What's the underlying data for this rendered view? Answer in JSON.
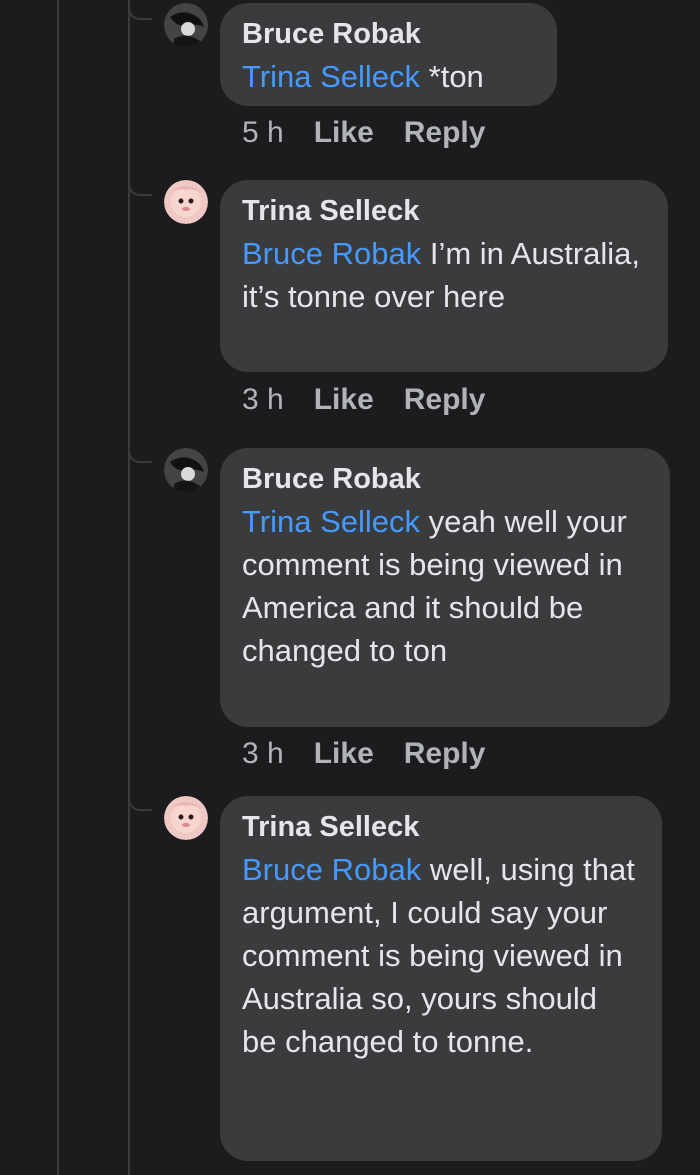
{
  "comments": [
    {
      "author": "Bruce Robak",
      "mention": "Trina Selleck",
      "text": " *ton",
      "time": "5 h",
      "like_label": "Like",
      "reply_label": "Reply",
      "avatar_icon": "dark-profile-avatar"
    },
    {
      "author": "Trina Selleck",
      "mention": "Bruce Robak",
      "text": " I’m in Australia, it’s tonne over here",
      "time": "3 h",
      "like_label": "Like",
      "reply_label": "Reply",
      "avatar_icon": "pink-profile-avatar"
    },
    {
      "author": "Bruce Robak",
      "mention": "Trina Selleck",
      "text": " yeah well your comment is being viewed in America and it should be changed to ton",
      "time": "3 h",
      "like_label": "Like",
      "reply_label": "Reply",
      "avatar_icon": "dark-profile-avatar"
    },
    {
      "author": "Trina Selleck",
      "mention": "Bruce Robak",
      "text": " well, using that argument, I could say your comment is being viewed in Australia so, yours should be changed to tonne.",
      "avatar_icon": "pink-profile-avatar"
    }
  ],
  "colors": {
    "background": "#1c1c1e",
    "bubble": "#3a3b3c",
    "mention": "#4599ff",
    "text": "#e4e6eb",
    "meta": "#b0b3b8"
  }
}
